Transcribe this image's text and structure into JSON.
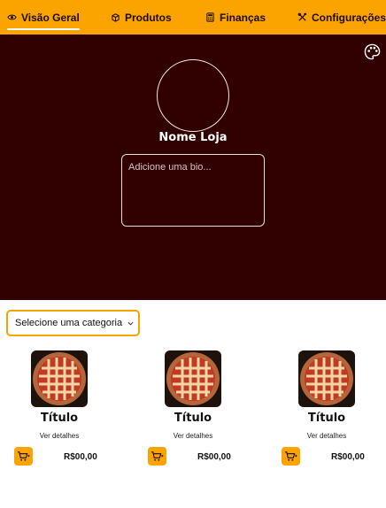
{
  "nav": {
    "items": [
      {
        "label": "Visão Geral",
        "icon": "eye-icon",
        "active": true
      },
      {
        "label": "Produtos",
        "icon": "box-icon",
        "active": false
      },
      {
        "label": "Finanças",
        "icon": "calculator-icon",
        "active": false
      },
      {
        "label": "Configurações",
        "icon": "tools-icon",
        "active": false
      }
    ]
  },
  "banner": {
    "background_color": "#310000",
    "palette_icon": "palette-icon",
    "store_name": "Nome Loja",
    "bio_placeholder": "Adicione uma bio..."
  },
  "category": {
    "selected": "Selecione uma categoria"
  },
  "products": [
    {
      "title": "Título",
      "details_label": "Ver detalhes",
      "price": "R$00,00"
    },
    {
      "title": "Título",
      "details_label": "Ver detalhes",
      "price": "R$00,00"
    },
    {
      "title": "Título",
      "details_label": "Ver detalhes",
      "price": "R$00,00"
    }
  ],
  "colors": {
    "accent": "#fba400",
    "text_dark": "#111111"
  }
}
